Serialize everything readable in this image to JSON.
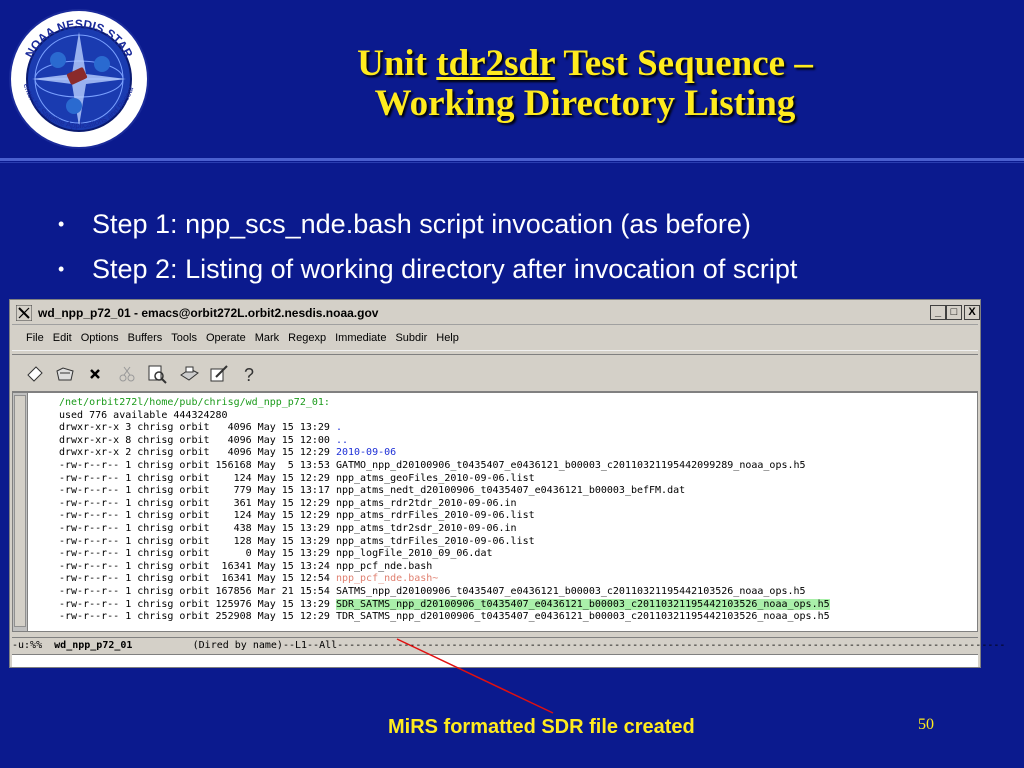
{
  "slide": {
    "title_part1": "Unit ",
    "title_underlined": "tdr2sdr",
    "title_part2": " Test Sequence –",
    "title_line2": "Working Directory Listing",
    "bullets": [
      "Step 1: npp_scs_nde.bash script invocation (as before)",
      "Step 2: Listing of working directory after invocation of script"
    ],
    "callout": "MiRS formatted SDR file created",
    "page_number": "50",
    "logo": {
      "top_text": "NOAA NESDIS STAR",
      "side_text": "Center for Satellite Applications and Research"
    }
  },
  "window": {
    "title": "wd_npp_p72_01 - emacs@orbit272L.orbit2.nesdis.noaa.gov",
    "controls": [
      "_",
      "□",
      "X"
    ],
    "menu": [
      "File",
      "Edit",
      "Options",
      "Buffers",
      "Tools",
      "Operate",
      "Mark",
      "Regexp",
      "Immediate",
      "Subdir",
      "Help"
    ],
    "toolbar_icons": [
      "new-file-icon",
      "open-folder-icon",
      "close-x-icon",
      "cut-icon",
      "search-icon",
      "print-icon",
      "edit-icon",
      "help-icon"
    ]
  },
  "listing": {
    "path": "/net/orbit272l/home/pub/chrisg/wd_npp_p72_01:",
    "summary": "used 776 available 444324280",
    "rows": [
      {
        "meta": "drwxr-xr-x 3 chrisg orbit   4096 May 15 13:29 ",
        "name": ".",
        "style": "blue"
      },
      {
        "meta": "drwxr-xr-x 8 chrisg orbit   4096 May 15 12:00 ",
        "name": "..",
        "style": "blue"
      },
      {
        "meta": "drwxr-xr-x 2 chrisg orbit   4096 May 15 12:29 ",
        "name": "2010-09-06",
        "style": "blue"
      },
      {
        "meta": "-rw-r--r-- 1 chrisg orbit 156168 May  5 13:53 ",
        "name": "GATMO_npp_d20100906_t0435407_e0436121_b00003_c20110321195442099289_noaa_ops.h5",
        "style": ""
      },
      {
        "meta": "-rw-r--r-- 1 chrisg orbit    124 May 15 12:29 ",
        "name": "npp_atms_geoFiles_2010-09-06.list",
        "style": ""
      },
      {
        "meta": "-rw-r--r-- 1 chrisg orbit    779 May 15 13:17 ",
        "name": "npp_atms_nedt_d20100906_t0435407_e0436121_b00003_befFM.dat",
        "style": ""
      },
      {
        "meta": "-rw-r--r-- 1 chrisg orbit    361 May 15 12:29 ",
        "name": "npp_atms_rdr2tdr_2010-09-06.in",
        "style": ""
      },
      {
        "meta": "-rw-r--r-- 1 chrisg orbit    124 May 15 12:29 ",
        "name": "npp_atms_rdrFiles_2010-09-06.list",
        "style": ""
      },
      {
        "meta": "-rw-r--r-- 1 chrisg orbit    438 May 15 13:29 ",
        "name": "npp_atms_tdr2sdr_2010-09-06.in",
        "style": ""
      },
      {
        "meta": "-rw-r--r-- 1 chrisg orbit    128 May 15 13:29 ",
        "name": "npp_atms_tdrFiles_2010-09-06.list",
        "style": ""
      },
      {
        "meta": "-rw-r--r-- 1 chrisg orbit      0 May 15 13:29 ",
        "name": "npp_logFile_2010_09_06.dat",
        "style": ""
      },
      {
        "meta": "-rw-r--r-- 1 chrisg orbit  16341 May 15 13:24 ",
        "name": "npp_pcf_nde.bash",
        "style": ""
      },
      {
        "meta": "-rw-r--r-- 1 chrisg orbit  16341 May 15 12:54 ",
        "name": "npp_pcf_nde.bash~",
        "style": "salmon"
      },
      {
        "meta": "-rw-r--r-- 1 chrisg orbit 167856 Mar 21 15:54 ",
        "name": "SATMS_npp_d20100906_t0435407_e0436121_b00003_c20110321195442103526_noaa_ops.h5",
        "style": ""
      },
      {
        "meta": "-rw-r--r-- 1 chrisg orbit 125976 May 15 13:29 ",
        "name": "SDR_SATMS_npp_d20100906_t0435407_e0436121_b00003_c20110321195442103526_noaa_ops.h5",
        "style": "hl"
      },
      {
        "meta": "-rw-r--r-- 1 chrisg orbit 252908 May 15 12:29 ",
        "name": "TDR_SATMS_npp_d20100906_t0435407_e0436121_b00003_c20110321195442103526_noaa_ops.h5",
        "style": ""
      }
    ],
    "modeline_left": "-u:%%  ",
    "modeline_buffer": "wd_npp_p72_01",
    "modeline_right": "          (Dired by name)--L1--All---------------------------------------------------------------------------------------------------------------"
  },
  "colors": {
    "background": "#0b1a8e",
    "title": "#ffeb1e",
    "bullet_text": "#ffffff",
    "directory": "#1d2fd6",
    "path": "#1a9a1a",
    "backup_file": "#e08070",
    "highlight": "#aaf0aa",
    "arrow": "#e01010"
  }
}
